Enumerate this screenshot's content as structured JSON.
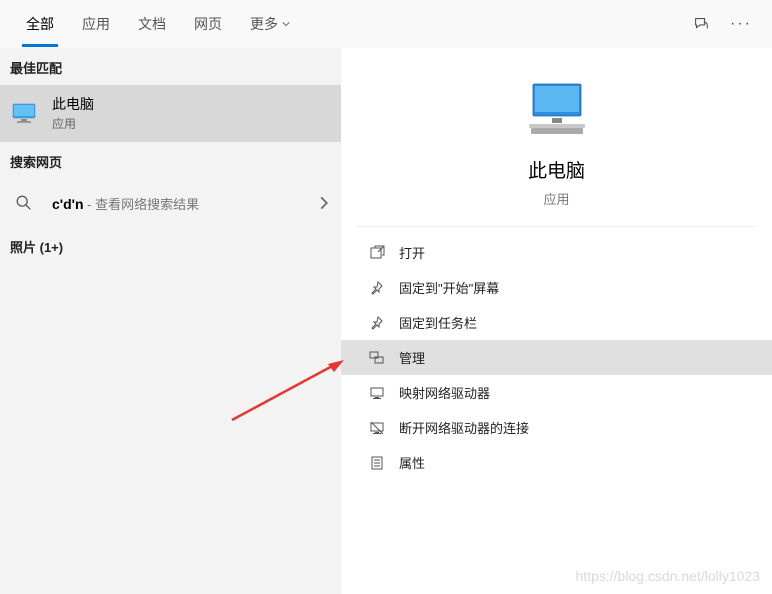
{
  "tabs": {
    "all": "全部",
    "apps": "应用",
    "docs": "文档",
    "web": "网页",
    "more": "更多"
  },
  "sections": {
    "best_match": "最佳匹配",
    "search_web": "搜索网页",
    "photos": "照片 (1+)"
  },
  "best_match": {
    "title": "此电脑",
    "sub": "应用"
  },
  "web_search": {
    "query": "c'd'n",
    "desc": " - 查看网络搜索结果"
  },
  "preview": {
    "title": "此电脑",
    "sub": "应用"
  },
  "actions": {
    "open": "打开",
    "pin_start": "固定到\"开始\"屏幕",
    "pin_taskbar": "固定到任务栏",
    "manage": "管理",
    "map_drive": "映射网络驱动器",
    "disconnect_drive": "断开网络驱动器的连接",
    "properties": "属性"
  },
  "watermark": "https://blog.csdn.net/lolly1023"
}
